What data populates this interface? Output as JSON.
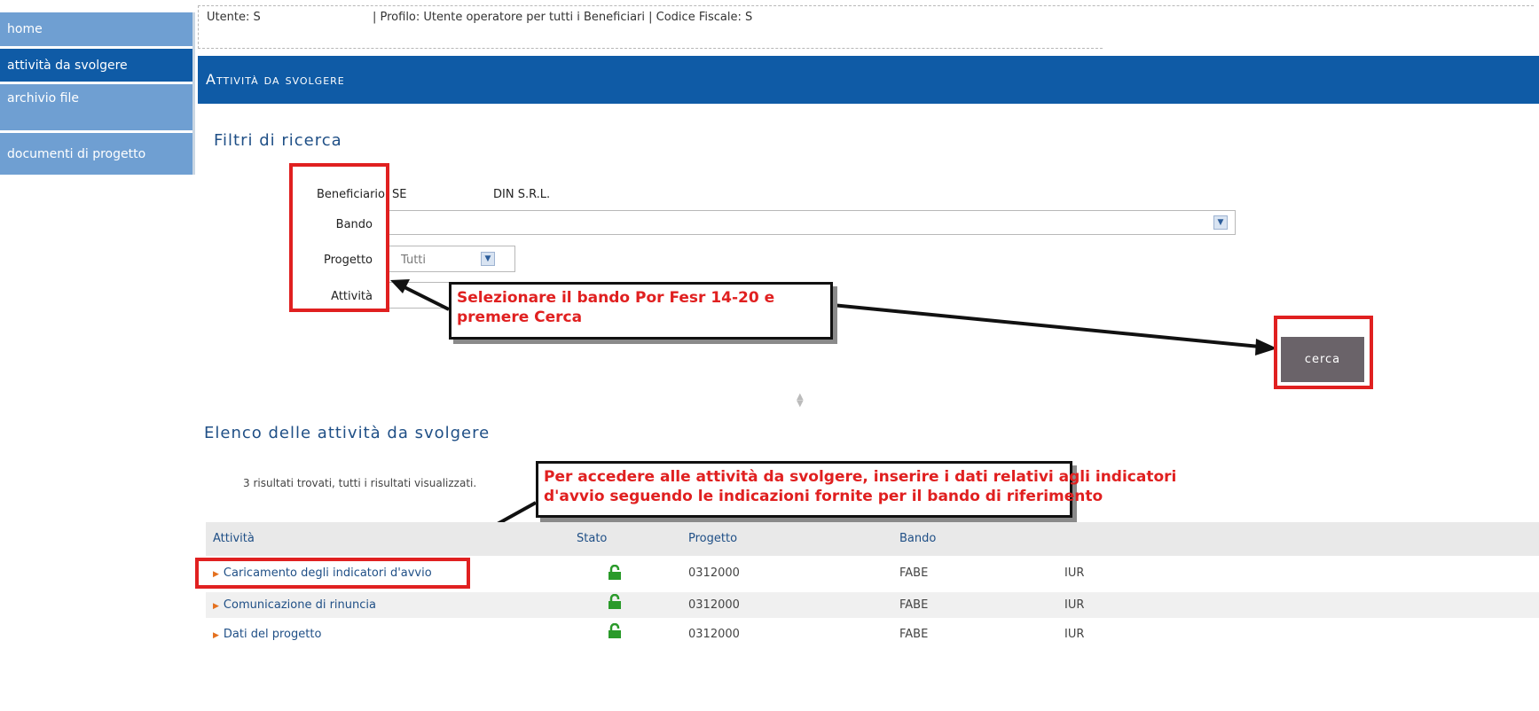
{
  "sidebar": {
    "items": [
      {
        "label": "home"
      },
      {
        "label": "attività da svolgere"
      },
      {
        "label": "archivio file"
      },
      {
        "label": "documenti di progetto"
      }
    ]
  },
  "userbar": {
    "user_label": "Utente: S",
    "profile_label": "| Profilo: Utente operatore per tutti i Beneficiari | Codice Fiscale: S"
  },
  "header": {
    "title": "Attività da svolgere"
  },
  "filters": {
    "title": "Filtri di ricerca",
    "beneficiario_label": "Beneficiario",
    "beneficiario_value_a": "SE",
    "beneficiario_value_b": "DIN S.R.L.",
    "bando_label": "Bando",
    "bando_value": "",
    "progetto_label": "Progetto",
    "progetto_value": "Tutti",
    "attivita_label": "Attività",
    "search_label": "cerca"
  },
  "callouts": {
    "top": [
      "Selezionare il bando Por Fesr 14-20 e",
      "premere Cerca"
    ],
    "bottom": [
      "Per accedere alle attività da svolgere, inserire i dati relativi agli indicatori",
      "d'avvio seguendo le indicazioni fornite per il bando di riferimento"
    ]
  },
  "list": {
    "title": "Elenco delle attività da svolgere",
    "results_text": "3 risultati trovati, tutti i risultati visualizzati.",
    "columns": [
      "Attività",
      "Stato",
      "Progetto",
      "Bando"
    ],
    "rows": [
      {
        "attivita": "Caricamento degli indicatori d'avvio",
        "progetto": "0312000",
        "bando_a": "FABE",
        "bando_b": "IUR"
      },
      {
        "attivita": "Comunicazione di rinuncia",
        "progetto": "0312000",
        "bando_a": "FABE",
        "bando_b": "IUR"
      },
      {
        "attivita": "Dati del progetto",
        "progetto": "0312000",
        "bando_a": "FABE",
        "bando_b": "IUR"
      }
    ]
  },
  "icons": {
    "lock": "unlocked-padlock-icon",
    "row_marker": "triangle-right-icon",
    "dropdown": "chevron-down-icon",
    "resize": "resize-handle-icon"
  },
  "colors": {
    "nav_active": "#0f5ba6",
    "nav_inactive": "#6f9fd2",
    "header": "#0f5ba6",
    "highlight": "#e02020",
    "search_button": "#6a6369",
    "lock_green": "#2a9a2a",
    "row_marker": "#e4701e"
  }
}
